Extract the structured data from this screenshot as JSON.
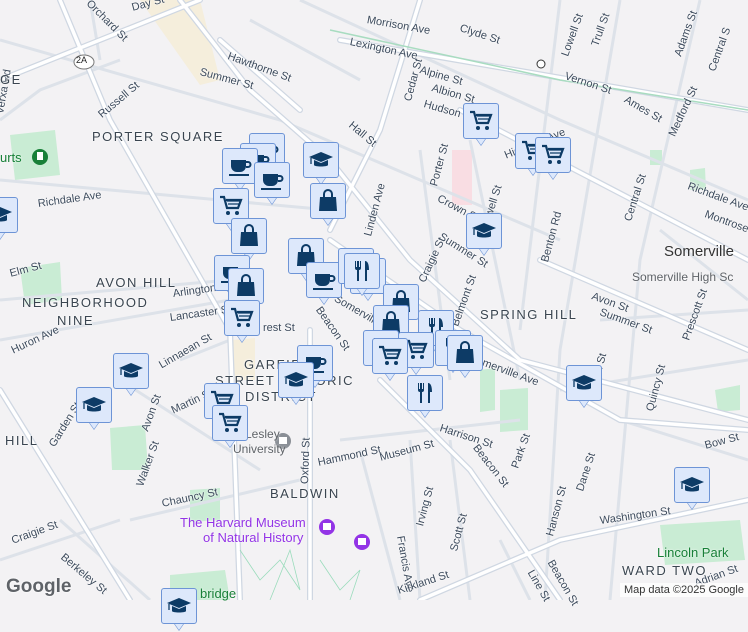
{
  "map": {
    "attribution": "Map data ©2025 Google",
    "logo": "Google",
    "districts": [
      "PORTER SQUARE",
      "AVON HILL",
      "NEIGHBORHOOD",
      "NINE",
      "SPRING HILL",
      "GARFIELD",
      "STREET HISTORIC",
      "DISTRICT",
      "BALDWIN",
      "WARD TWO",
      "HILL",
      "GE"
    ],
    "cities": [
      "Somerville"
    ],
    "pois": {
      "museum_line1": "The Harvard Museum",
      "museum_line2": "of Natural History",
      "lesley_line1": "Lesley",
      "lesley_line2": "University",
      "lincoln_park": "Lincoln Park",
      "high_school": "Somerville High Sc",
      "courts": "urts",
      "cambridge": "bridge"
    },
    "streets": [
      "Morrison Ave",
      "Clyde St",
      "Lexington Ave",
      "Alpine St",
      "Albion St",
      "Hudson St",
      "Cedar St",
      "Lowell St",
      "Trull St",
      "Adams St",
      "Central S",
      "Vernon St",
      "Ames St",
      "Medford St",
      "Day St",
      "Orchard St",
      "Hawthorne St",
      "Summer St",
      "Russell St",
      "Hall St",
      "Highland Ave",
      "Porter St",
      "Crown St",
      "Lowell St",
      "Richdale Ave",
      "Montrose St",
      "Central St",
      "Richdale Ave",
      "Linden Ave",
      "Summer St",
      "Benton Rd",
      "Craigie St",
      "Arlington",
      "Summer St",
      "Avon St",
      "Prescott St",
      "Lancaster St",
      "rest St",
      "Beacon St",
      "Somerville Ave",
      "Belmont St",
      "Huron Ave",
      "Linnaean St",
      "Laurel St",
      "Quincy St",
      "Garden St",
      "Avon St",
      "Martin St",
      "Walker St",
      "Hammond St",
      "Museum St",
      "Harrison St",
      "Beacon St",
      "Park St",
      "Dane St",
      "Bow St",
      "Oxford St",
      "Chauncy St",
      "Irving St",
      "Hanson St",
      "Scott St",
      "Washington St",
      "Craigie St",
      "Berkeley St",
      "Francis Ave",
      "Kirkland St",
      "Line St",
      "Beacon St",
      "Adrian St",
      "Verxa Rd",
      "Somerville Ave",
      "Elm St"
    ],
    "route_shield": "2A",
    "markers": [
      {
        "icon": "cart"
      },
      {
        "icon": "cart"
      },
      {
        "icon": "cart"
      },
      {
        "icon": "graduation-cap"
      },
      {
        "icon": "coffee"
      },
      {
        "icon": "coffee"
      },
      {
        "icon": "coffee"
      },
      {
        "icon": "coffee"
      },
      {
        "icon": "bag"
      },
      {
        "icon": "cart"
      },
      {
        "icon": "bag"
      },
      {
        "icon": "graduation-cap"
      },
      {
        "icon": "bag"
      },
      {
        "icon": "coffee"
      },
      {
        "icon": "coffee"
      },
      {
        "icon": "bag"
      },
      {
        "icon": "restaurant"
      },
      {
        "icon": "bag"
      },
      {
        "icon": "bag"
      },
      {
        "icon": "cart"
      },
      {
        "icon": "restaurant"
      },
      {
        "icon": "bag"
      },
      {
        "icon": "restaurant"
      },
      {
        "icon": "restaurant"
      },
      {
        "icon": "restaurant"
      },
      {
        "icon": "cart"
      },
      {
        "icon": "cart"
      },
      {
        "icon": "bag"
      },
      {
        "icon": "coffee"
      },
      {
        "icon": "graduation-cap"
      },
      {
        "icon": "graduation-cap"
      },
      {
        "icon": "graduation-cap"
      },
      {
        "icon": "cart"
      },
      {
        "icon": "cart"
      },
      {
        "icon": "restaurant"
      },
      {
        "icon": "graduation-cap"
      },
      {
        "icon": "graduation-cap"
      },
      {
        "icon": "graduation-cap"
      },
      {
        "icon": "graduation-cap"
      }
    ],
    "colors": {
      "background": "#f3f2f4",
      "road": "#ffffff",
      "road_edge": "#d5dbe3",
      "park": "#c9ecd4",
      "marker_fill": "#dde8fb",
      "marker_border": "#6d94d6",
      "icon": "#0d3b66"
    }
  }
}
